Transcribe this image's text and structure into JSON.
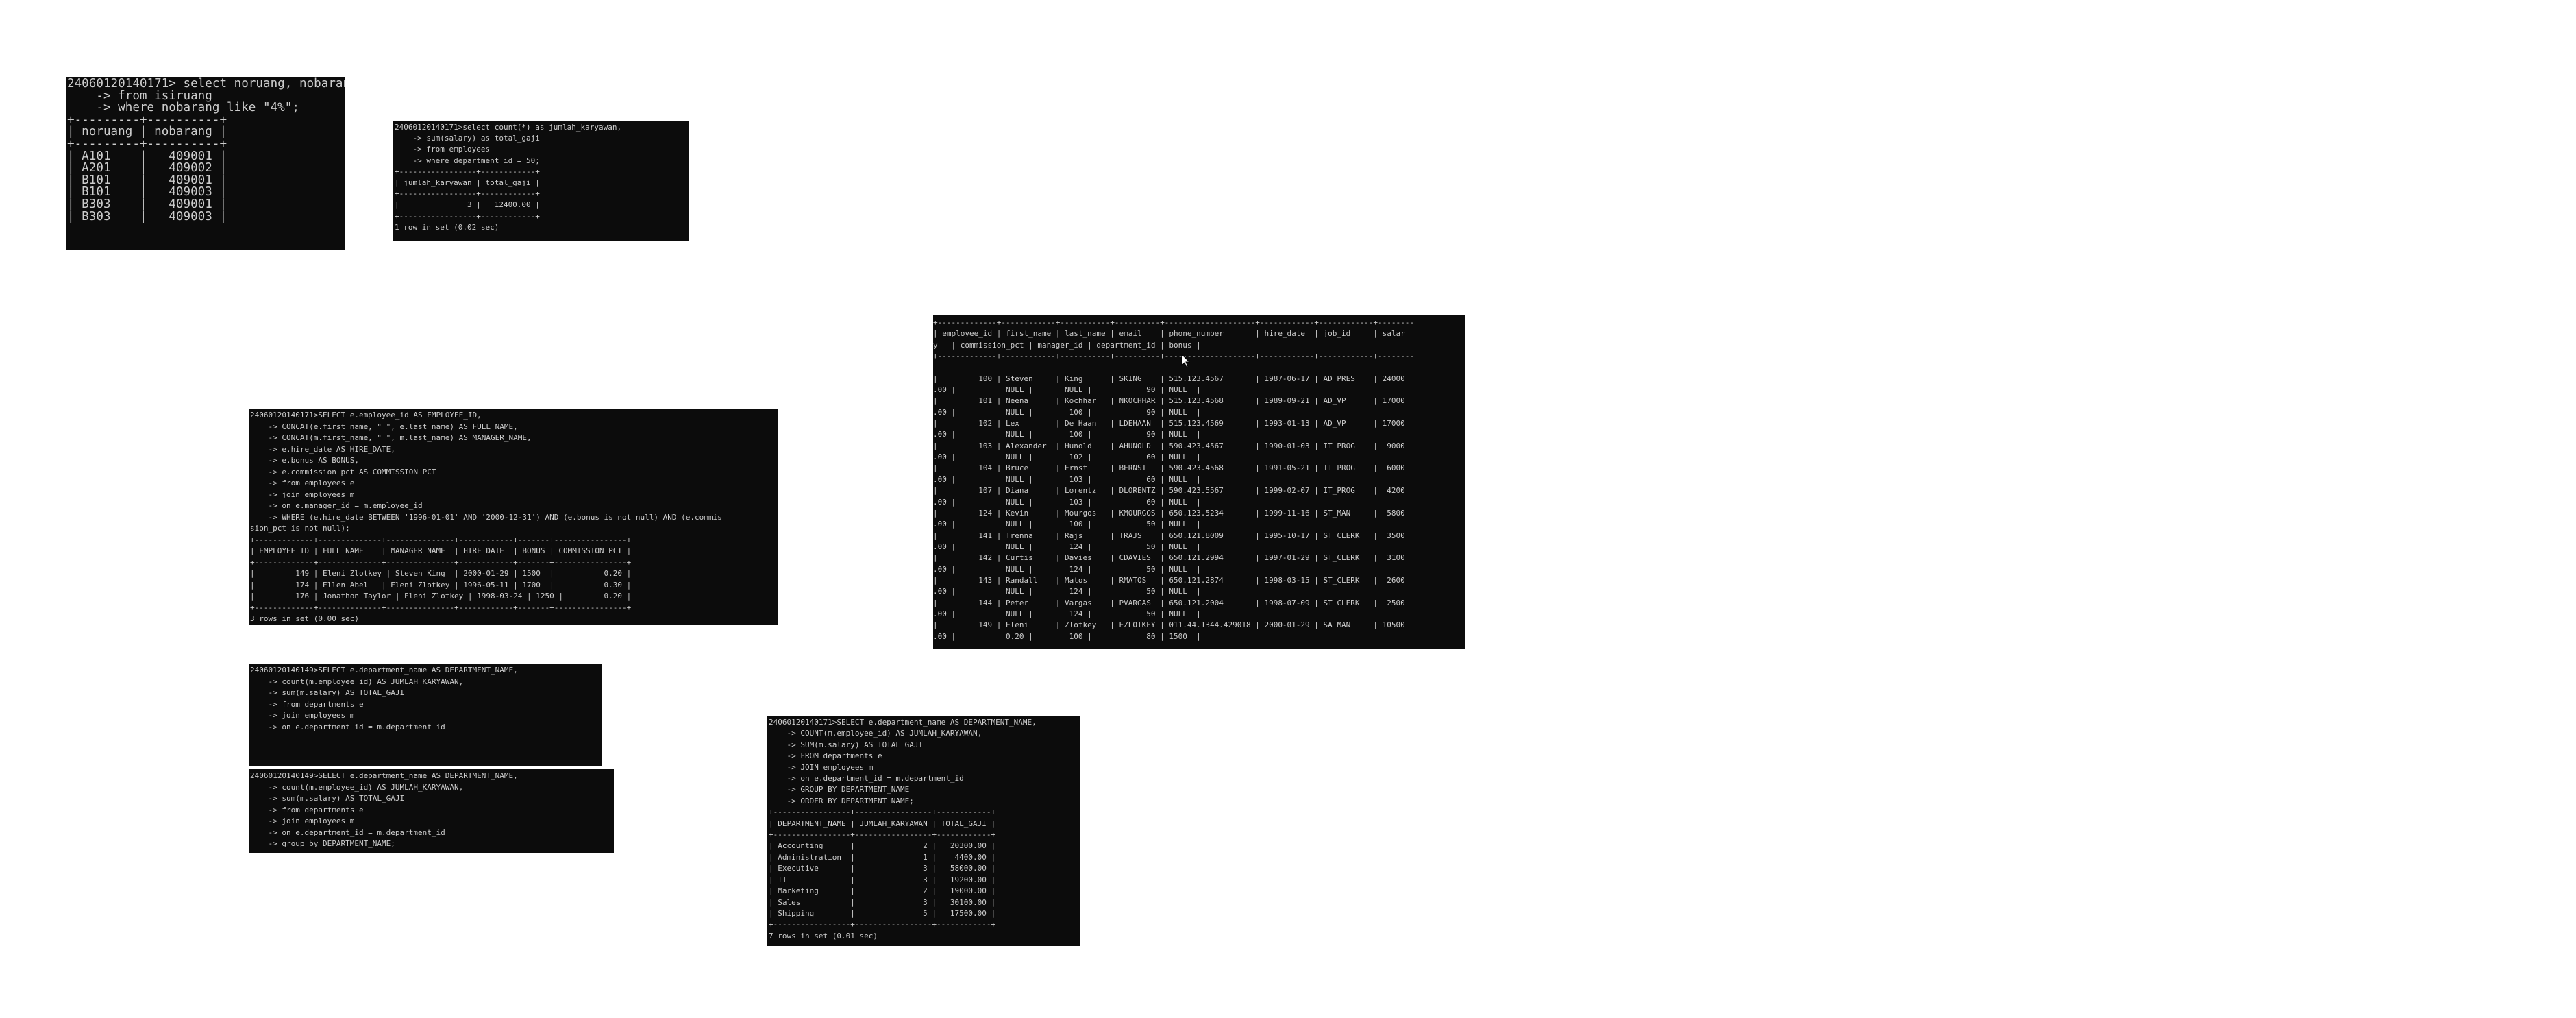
{
  "terminals": {
    "t1": {
      "text": "24060120140171> select noruang, nobarang\n    -> from isiruang\n    -> where nobarang like \"4%\";\n+---------+----------+\n| noruang | nobarang |\n+---------+----------+\n| A101    |   409001 |\n| A201    |   409002 |\n| B101    |   409001 |\n| B101    |   409003 |\n| B303    |   409001 |\n| B303    |   409003 |"
    },
    "t2": {
      "text": "24060120140171>select count(*) as jumlah_karyawan,\n    -> sum(salary) as total_gaji\n    -> from employees\n    -> where department_id = 50;\n+-----------------+------------+\n| jumlah_karyawan | total_gaji |\n+-----------------+------------+\n|               3 |   12400.00 |\n+-----------------+------------+\n1 row in set (0.02 sec)"
    },
    "t3": {
      "text": "+-------------+------------+-----------+----------+--------------------+------------+------------+--------\n| employee_id | first_name | last_name | email    | phone_number       | hire_date  | job_id     | salar\ny   | commission_pct | manager_id | department_id | bonus |\n+-------------+------------+-----------+----------+--------------------+------------+------------+--------\n\n|         100 | Steven     | King      | SKING    | 515.123.4567       | 1987-06-17 | AD_PRES    | 24000\n.00 |           NULL |       NULL |            90 | NULL  |\n|         101 | Neena      | Kochhar   | NKOCHHAR | 515.123.4568       | 1989-09-21 | AD_VP      | 17000\n.00 |           NULL |        100 |            90 | NULL  |\n|         102 | Lex        | De Haan   | LDEHAAN  | 515.123.4569       | 1993-01-13 | AD_VP      | 17000\n.00 |           NULL |        100 |            90 | NULL  |\n|         103 | Alexander  | Hunold    | AHUNOLD  | 590.423.4567       | 1990-01-03 | IT_PROG    |  9000\n.00 |           NULL |        102 |            60 | NULL  |\n|         104 | Bruce      | Ernst     | BERNST   | 590.423.4568       | 1991-05-21 | IT_PROG    |  6000\n.00 |           NULL |        103 |            60 | NULL  |\n|         107 | Diana      | Lorentz   | DLORENTZ | 590.423.5567       | 1999-02-07 | IT_PROG    |  4200\n.00 |           NULL |        103 |            60 | NULL  |\n|         124 | Kevin      | Mourgos   | KMOURGOS | 650.123.5234       | 1999-11-16 | ST_MAN     |  5800\n.00 |           NULL |        100 |            50 | NULL  |\n|         141 | Trenna     | Rajs      | TRAJS    | 650.121.8009       | 1995-10-17 | ST_CLERK   |  3500\n.00 |           NULL |        124 |            50 | NULL  |\n|         142 | Curtis     | Davies    | CDAVIES  | 650.121.2994       | 1997-01-29 | ST_CLERK   |  3100\n.00 |           NULL |        124 |            50 | NULL  |\n|         143 | Randall    | Matos     | RMATOS   | 650.121.2874       | 1998-03-15 | ST_CLERK   |  2600\n.00 |           NULL |        124 |            50 | NULL  |\n|         144 | Peter      | Vargas    | PVARGAS  | 650.121.2004       | 1998-07-09 | ST_CLERK   |  2500\n.00 |           NULL |        124 |            50 | NULL  |\n|         149 | Eleni      | Zlotkey   | EZLOTKEY | 011.44.1344.429018 | 2000-01-29 | SA_MAN     | 10500\n.00 |           0.20 |        100 |            80 | 1500  |"
    },
    "t4": {
      "text": "24060120140171>SELECT e.employee_id AS EMPLOYEE_ID,\n    -> CONCAT(e.first_name, \" \", e.last_name) AS FULL_NAME,\n    -> CONCAT(m.first_name, \" \", m.last_name) AS MANAGER_NAME,\n    -> e.hire_date AS HIRE_DATE,\n    -> e.bonus AS BONUS,\n    -> e.commission_pct AS COMMISSION_PCT\n    -> from employees e\n    -> join employees m\n    -> on e.manager_id = m.employee_id\n    -> WHERE (e.hire_date BETWEEN '1996-01-01' AND '2000-12-31') AND (e.bonus is not null) AND (e.commis\nsion_pct is not null);\n+-------------+--------------+---------------+------------+-------+----------------+\n| EMPLOYEE_ID | FULL_NAME    | MANAGER_NAME  | HIRE_DATE  | BONUS | COMMISSION_PCT |\n+-------------+--------------+---------------+------------+-------+----------------+\n|         149 | Eleni Zlotkey | Steven King  | 2000-01-29 | 1500  |           0.20 |\n|         174 | Ellen Abel   | Eleni Zlotkey | 1996-05-11 | 1700  |           0.30 |\n|         176 | Jonathon Taylor | Eleni Zlotkey | 1998-03-24 | 1250 |         0.20 |\n+-------------+--------------+---------------+------------+-------+----------------+\n3 rows in set (0.00 sec)"
    },
    "t5": {
      "text": "24060120140149>SELECT e.department_name AS DEPARTMENT_NAME,\n    -> count(m.employee_id) AS JUMLAH_KARYAWAN,\n    -> sum(m.salary) AS TOTAL_GAJI\n    -> from departments e\n    -> join employees m\n    -> on e.department_id = m.department_id"
    },
    "t6": {
      "text": "24060120140149>SELECT e.department_name AS DEPARTMENT_NAME,\n    -> count(m.employee_id) AS JUMLAH_KARYAWAN,\n    -> sum(m.salary) AS TOTAL_GAJI\n    -> from departments e\n    -> join employees m\n    -> on e.department_id = m.department_id\n    -> group by DEPARTMENT_NAME;"
    },
    "t7": {
      "text": "24060120140171>SELECT e.department_name AS DEPARTMENT_NAME,\n    -> COUNT(m.employee_id) AS JUMLAH_KARYAWAN,\n    -> SUM(m.salary) AS TOTAL_GAJI\n    -> FROM departments e\n    -> JOIN employees m\n    -> on e.department_id = m.department_id\n    -> GROUP BY DEPARTMENT_NAME\n    -> ORDER BY DEPARTMENT_NAME;\n+-----------------+-----------------+------------+\n| DEPARTMENT_NAME | JUMLAH_KARYAWAN | TOTAL_GAJI |\n+-----------------+-----------------+------------+\n| Accounting      |               2 |   20300.00 |\n| Administration  |               1 |    4400.00 |\n| Executive       |               3 |   58000.00 |\n| IT              |               3 |   19200.00 |\n| Marketing       |               2 |   19000.00 |\n| Sales           |               3 |   30100.00 |\n| Shipping        |               5 |   17500.00 |\n+-----------------+-----------------+------------+\n7 rows in set (0.01 sec)"
    }
  },
  "colors": {
    "terminal_bg": "#0c0c0c",
    "terminal_fg": "#cccccc",
    "page_bg": "#ffffff"
  }
}
